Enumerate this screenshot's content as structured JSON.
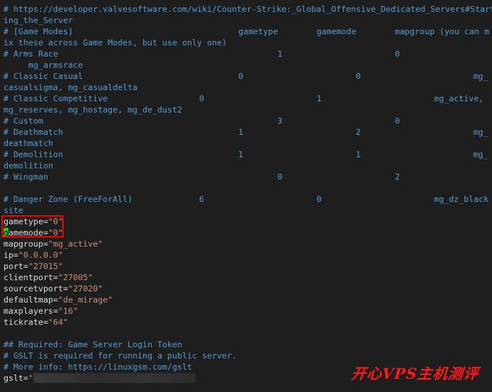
{
  "terminal": {
    "comments": {
      "url_a": "# https://developer.valvesoftware.com/wiki/Counter-Strike:_Global_Offensive_Dedicated_Servers#Start",
      "url_b": "ing_the_Server",
      "modes_header": "# [Game Modes]",
      "col_gametype": "gametype",
      "col_gamemode": "gamemode",
      "col_mapgroup": "mapgroup (you can m",
      "modes_note": "ix these across Game Modes, but use only one)"
    },
    "game_modes": [
      {
        "name": "# Arms Race",
        "gametype": "1",
        "gamemode": "0",
        "mapgroup_a": "",
        "mapgroup_b": "     mg_armsrace"
      },
      {
        "name": "# Classic Casual",
        "gametype": "0",
        "gamemode": "0",
        "mapgroup_a": "mg_",
        "mapgroup_b": "casualsigma, mg_casualdelta"
      },
      {
        "name": "# Classic Competitive",
        "gametype": "0",
        "gamemode": "1",
        "mapgroup_a": "mg_active,",
        "mapgroup_b": "mg_reserves, mg_hostage, mg_de_dust2"
      },
      {
        "name": "# Custom",
        "gametype": "3",
        "gamemode": "0",
        "mapgroup_a": "",
        "mapgroup_b": ""
      },
      {
        "name": "# Deathmatch",
        "gametype": "1",
        "gamemode": "2",
        "mapgroup_a": "mg_",
        "mapgroup_b": "deathmatch"
      },
      {
        "name": "# Demolition",
        "gametype": "1",
        "gamemode": "1",
        "mapgroup_a": "mg_",
        "mapgroup_b": "demolition"
      },
      {
        "name": "# Wingman",
        "gametype": "0",
        "gamemode": "2",
        "mapgroup_a": "",
        "mapgroup_b": ""
      },
      {
        "name": "# Danger Zone (FreeForAll)",
        "gametype": "6",
        "gamemode": "0",
        "mapgroup_a": "mg_dz_black",
        "mapgroup_b": "site"
      }
    ],
    "settings": [
      {
        "key": "gametype=",
        "value": "\"0\""
      },
      {
        "key": "amemode=",
        "value": "\"0\"",
        "cursor_char": "g"
      },
      {
        "key": "mapgroup=",
        "value": "\"mg_active\""
      },
      {
        "key": "ip=",
        "value": "\"0.0.0.0\""
      },
      {
        "key": "port=",
        "value": "\"27015\""
      },
      {
        "key": "clientport=",
        "value": "\"27005\""
      },
      {
        "key": "sourcetvport=",
        "value": "\"27020\""
      },
      {
        "key": "defaultmap=",
        "value": "\"de_mirage\""
      },
      {
        "key": "maxplayers=",
        "value": "\"16\""
      },
      {
        "key": "tickrate=",
        "value": "\"64\""
      }
    ],
    "gslt_comments": [
      "## Required: Game Server Login Token",
      "# GSLT is required for running a public server.",
      "# More info: https://linuxgsm.com/gslt"
    ],
    "gslt_key": "gslt=",
    "gslt_quote": "\""
  },
  "watermark": "开心VPS主机测评",
  "colors": {
    "background": "#1e1e1e",
    "comment": "#569cd6",
    "key": "#dcdcdc",
    "string": "#ce9178",
    "cursor": "#22c83a",
    "highlight": "#ff0000",
    "watermark": "#ff1a1a"
  }
}
